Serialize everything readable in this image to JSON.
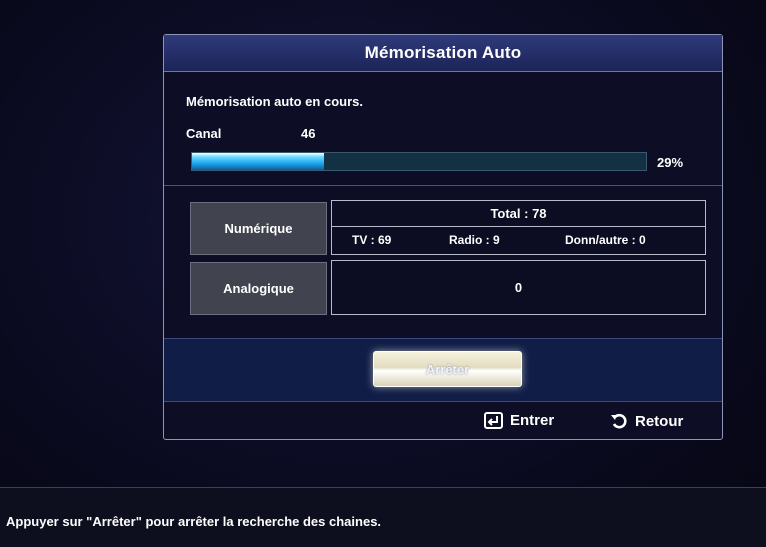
{
  "dialog": {
    "title": "Mémorisation Auto",
    "status": "Mémorisation auto en cours.",
    "channel_label": "Canal",
    "channel_value": "46",
    "progress_percent": 29,
    "progress_text": "29%"
  },
  "results": {
    "digital": {
      "label": "Numérique",
      "total": "Total : 78",
      "tv": "TV : 69",
      "radio": "Radio : 9",
      "data_other": "Donn/autre : 0"
    },
    "analog": {
      "label": "Analogique",
      "value": "0"
    }
  },
  "buttons": {
    "stop_label": "Arrêter"
  },
  "footer_keys": {
    "enter_label": "Entrer",
    "return_label": "Retour",
    "enter_icon": "enter-key-icon",
    "return_icon": "return-arrow-icon"
  },
  "hint": "Appuyer sur \"Arrêter\" pour arrêter la recherche des chaines.",
  "colors": {
    "title_bar": "#2f3a7a",
    "progress_fill": "#1ea7ef",
    "progress_track": "#123244",
    "button_band": "#101d47",
    "label_cell": "#41434f"
  }
}
